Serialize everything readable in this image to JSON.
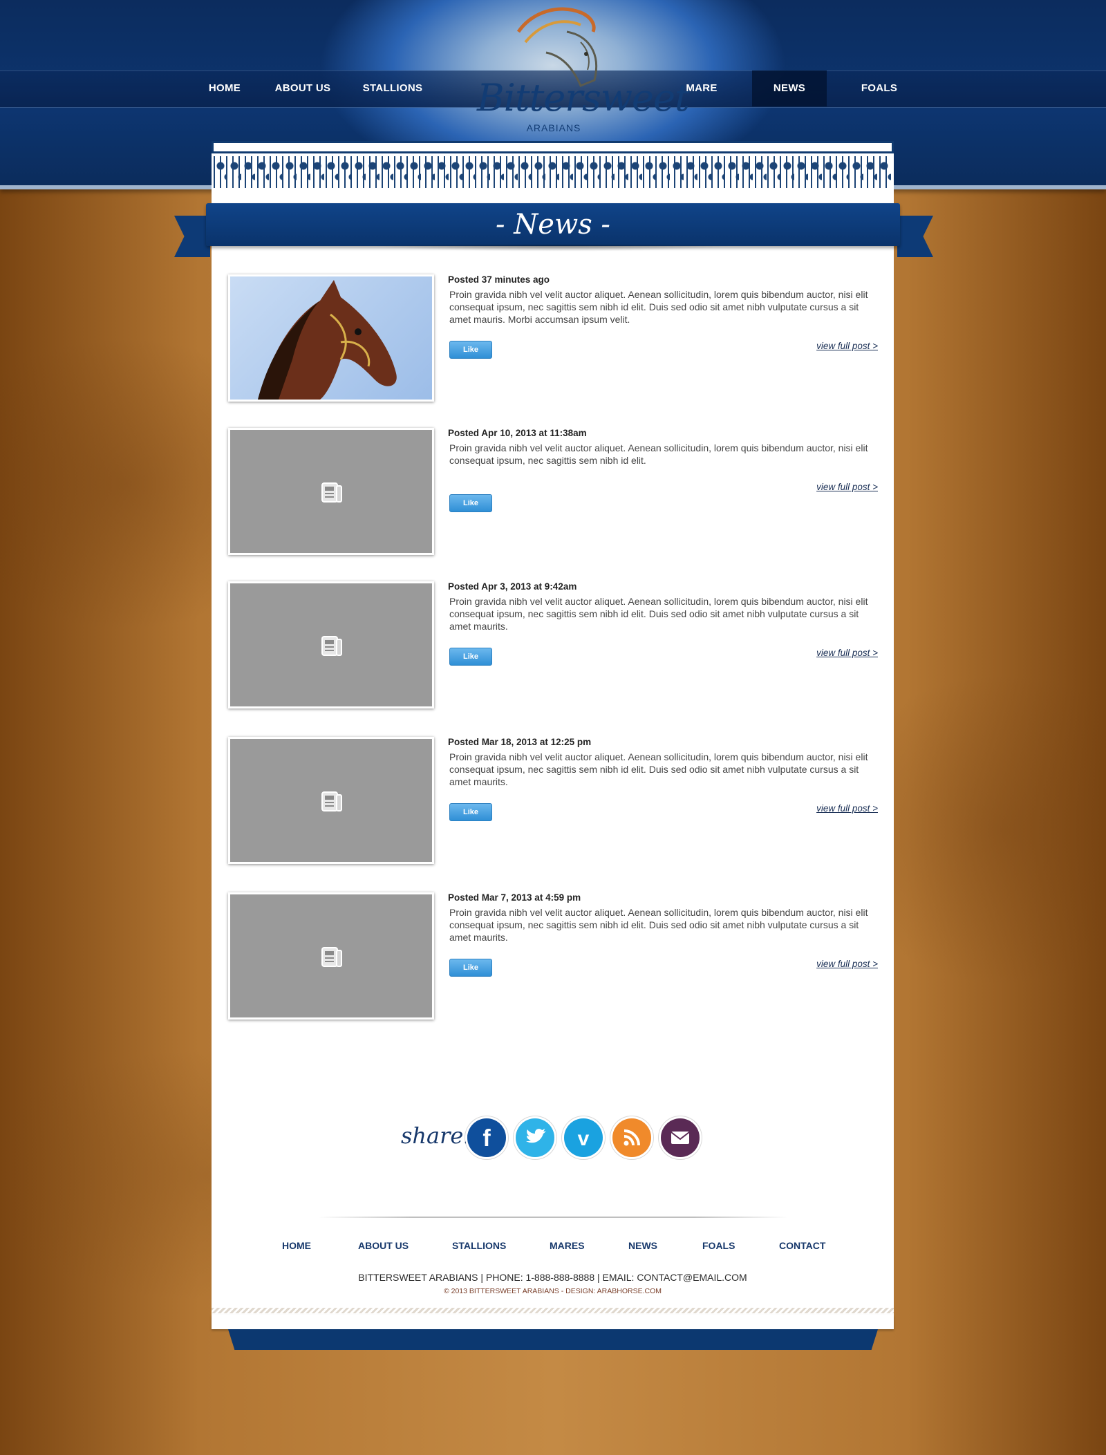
{
  "header": {
    "nav_left": [
      "HOME",
      "ABOUT US",
      "STALLIONS"
    ],
    "nav_right": [
      "MARE",
      "NEWS",
      "FOALS"
    ],
    "active": "NEWS",
    "logo_name": "Bittersweet",
    "logo_sub": "ARABIANS"
  },
  "banner": {
    "title": "- News -"
  },
  "posts": [
    {
      "date": "Posted 37 minutes ago",
      "body": "Proin gravida nibh vel velit auctor aliquet. Aenean sollicitudin, lorem quis bibendum auctor, nisi elit consequat ipsum, nec sagittis sem nibh id elit. Duis sed odio sit amet nibh vulputate cursus a sit amet mauris. Morbi accumsan ipsum velit.",
      "like": "Like",
      "link": "view full post >",
      "image": "horse-photo"
    },
    {
      "date": "Posted Apr 10, 2013 at 11:38am",
      "body": "Proin gravida nibh vel velit auctor aliquet. Aenean sollicitudin, lorem quis bibendum auctor, nisi elit consequat ipsum, nec sagittis sem nibh id elit.",
      "like": "Like",
      "link": "view full post >",
      "image": "placeholder"
    },
    {
      "date": "Posted Apr 3, 2013 at 9:42am",
      "body": "Proin gravida nibh vel velit auctor aliquet. Aenean sollicitudin, lorem quis bibendum auctor, nisi elit consequat ipsum, nec sagittis sem nibh id elit. Duis sed odio sit amet nibh vulputate cursus a sit amet maurits.",
      "like": "Like",
      "link": "view full post >",
      "image": "placeholder"
    },
    {
      "date": "Posted Mar 18, 2013 at 12:25 pm",
      "body": "Proin gravida nibh vel velit auctor aliquet. Aenean sollicitudin, lorem quis bibendum auctor, nisi elit consequat ipsum, nec sagittis sem nibh id elit. Duis sed odio sit amet nibh vulputate cursus a sit amet maurits.",
      "like": "Like",
      "link": "view full post >",
      "image": "placeholder"
    },
    {
      "date": "Posted Mar 7, 2013 at 4:59 pm",
      "body": "Proin gravida nibh vel velit auctor aliquet. Aenean sollicitudin, lorem quis bibendum auctor, nisi elit consequat ipsum, nec sagittis sem nibh id elit. Duis sed odio sit amet nibh vulputate cursus a sit amet maurits.",
      "like": "Like",
      "link": "view full post >",
      "image": "placeholder"
    }
  ],
  "share": {
    "label": "share:",
    "icons": [
      {
        "name": "facebook-icon",
        "glyph": "f",
        "color": "#0f4f9c"
      },
      {
        "name": "twitter-icon",
        "glyph": "✒",
        "color": "#2fb3e8"
      },
      {
        "name": "vimeo-icon",
        "glyph": "v",
        "color": "#1aa2e0"
      },
      {
        "name": "rss-icon",
        "glyph": "◢",
        "color": "#f08a2b"
      },
      {
        "name": "email-icon",
        "glyph": "✉",
        "color": "#5a2a55"
      }
    ]
  },
  "footer": {
    "links": [
      "HOME",
      "ABOUT US",
      "STALLIONS",
      "MARES",
      "NEWS",
      "FOALS",
      "CONTACT"
    ],
    "contact": "BITTERSWEET ARABIANS  |  PHONE: 1-888-888-8888  |  EMAIL: CONTACT@EMAIL.COM",
    "copyright": "© 2013 BITTERSWEET ARABIANS - DESIGN: ARABHORSE.COM"
  }
}
